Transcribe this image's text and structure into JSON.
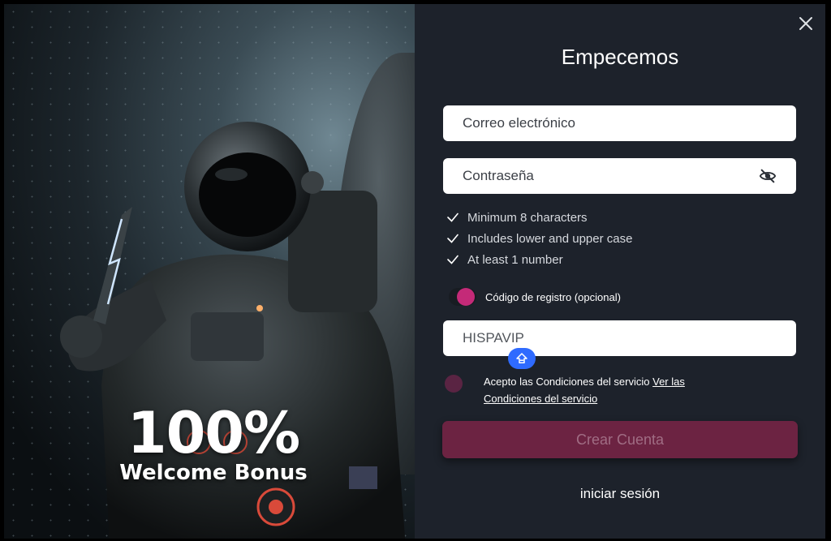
{
  "promo": {
    "headline": "100%",
    "subheadline": "Welcome Bonus"
  },
  "form": {
    "title": "Empecemos",
    "email_placeholder": "Correo electrónico",
    "password_placeholder": "Contraseña",
    "password_rules": [
      "Minimum 8 characters",
      "Includes lower and upper case",
      "At least 1 number"
    ],
    "registration_code_toggle_label": "Código de registro (opcional)",
    "registration_code_value": "HISPAVIP",
    "terms_text": "Acepto las Condiciones del servicio ",
    "terms_link": "Ver las Condiciones del servicio",
    "create_button": "Crear Cuenta",
    "login_link": "iniciar sesión"
  },
  "icons": {
    "close": "close-icon",
    "eye": "eye-off-icon",
    "check": "check-icon",
    "badge": "arrow-up-icon"
  },
  "colors": {
    "panel_bg": "#1d222b",
    "accent": "#c42a78",
    "button_bg": "#6c2342",
    "badge": "#2f6bff"
  }
}
